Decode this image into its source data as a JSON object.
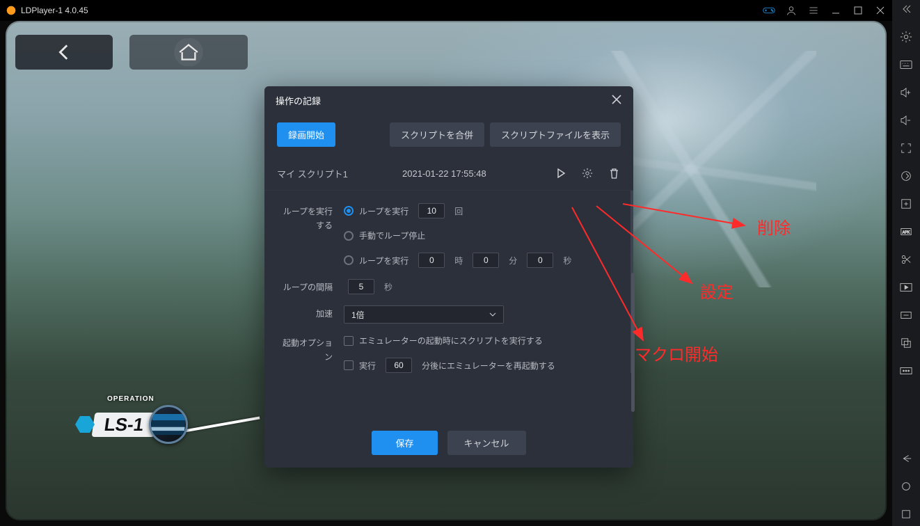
{
  "titlebar": {
    "title": "LDPlayer-1 4.0.45"
  },
  "dialog": {
    "title": "操作の記録",
    "record_btn": "録画開始",
    "merge_btn": "スクリプトを合併",
    "showfile_btn": "スクリプトファイルを表示",
    "script": {
      "name": "マイ スクリプト1",
      "timestamp": "2021-01-22 17:55:48"
    },
    "loop": {
      "label": "ループを実行する",
      "opt1_prefix": "ループを実行",
      "opt1_count": "10",
      "opt1_suffix": "回",
      "opt2": "手動でループ停止",
      "opt3_prefix": "ループを実行",
      "opt3_h": "0",
      "opt3_hu": "時",
      "opt3_m": "0",
      "opt3_mu": "分",
      "opt3_s": "0",
      "opt3_su": "秒"
    },
    "interval": {
      "label": "ループの間隔",
      "value": "5",
      "unit": "秒"
    },
    "accel": {
      "label": "加速",
      "value": "1倍"
    },
    "startup": {
      "label": "起動オプション",
      "opt1": "エミュレーターの起動時にスクリプトを実行する",
      "opt2_prefix": "実行",
      "opt2_value": "60",
      "opt2_suffix": "分後にエミュレーターを再起動する"
    },
    "save_btn": "保存",
    "cancel_btn": "キャンセル"
  },
  "stage": {
    "operation": "OPERATION",
    "code": "LS-1"
  },
  "annotations": {
    "delete": "削除",
    "settings": "設定",
    "macro_start": "マクロ開始"
  },
  "colors": {
    "accent": "#1f8ff0",
    "danger": "#ff2a2a"
  }
}
